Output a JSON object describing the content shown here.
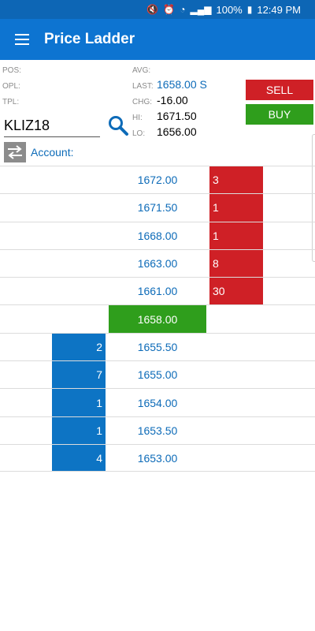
{
  "status_bar": {
    "battery": "100%",
    "time": "12:49 PM"
  },
  "app": {
    "title": "Price Ladder"
  },
  "info": {
    "labels": {
      "pos": "POS:",
      "opl": "OPL:",
      "tpl": "TPL:",
      "avg": "AVG:",
      "last": "LAST:",
      "chg": "CHG:",
      "hi": "HI:",
      "lo": "LO:"
    },
    "values": {
      "last": "1658.00 S",
      "chg": "-16.00",
      "hi": "1671.50",
      "lo": "1656.00"
    },
    "symbol": "KLIZ18",
    "account_label": "Account:"
  },
  "buttons": {
    "sell": "SELL",
    "buy": "BUY"
  },
  "ladder": [
    {
      "bid": "",
      "price": "1672.00",
      "ask": "3"
    },
    {
      "bid": "",
      "price": "1671.50",
      "ask": "1"
    },
    {
      "bid": "",
      "price": "1668.00",
      "ask": "1"
    },
    {
      "bid": "",
      "price": "1663.00",
      "ask": "8"
    },
    {
      "bid": "",
      "price": "1661.00",
      "ask": "30"
    },
    {
      "bid": "",
      "price": "1658.00",
      "ask": "",
      "last": true
    },
    {
      "bid": "2",
      "price": "1655.50",
      "ask": ""
    },
    {
      "bid": "7",
      "price": "1655.00",
      "ask": ""
    },
    {
      "bid": "1",
      "price": "1654.00",
      "ask": ""
    },
    {
      "bid": "1",
      "price": "1653.50",
      "ask": ""
    },
    {
      "bid": "4",
      "price": "1653.00",
      "ask": ""
    }
  ],
  "colors": {
    "appbar": "#0d74d1",
    "sell": "#cf2026",
    "buy": "#2f9e1c",
    "bid": "#0d74c4",
    "price_text": "#0d6bb8"
  },
  "icons": {
    "menu": "hamburger-icon",
    "search": "search-icon",
    "account": "swap-arrows-icon"
  }
}
